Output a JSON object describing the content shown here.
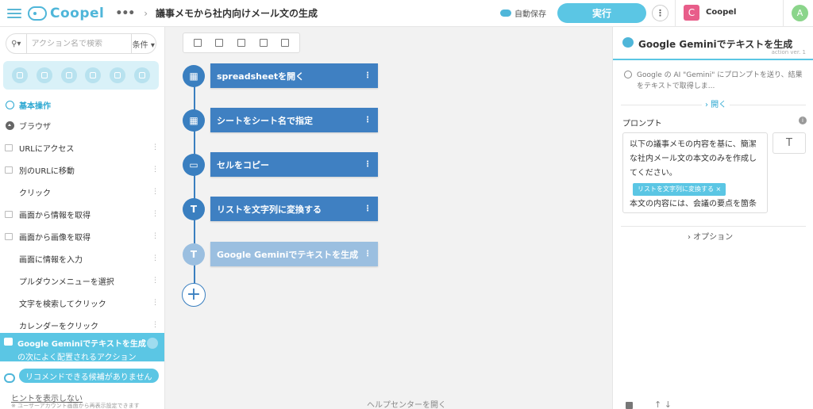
{
  "header": {
    "logo_text": "Coopel",
    "more_label": "•••",
    "breadcrumb_arrow": "›",
    "title": "議事メモから社内向けメール文の生成",
    "autosave": "自動保存",
    "run_button": "実行",
    "workspace_initial": "C",
    "workspace_name": "Coopel",
    "user_initial": "A"
  },
  "sidebar": {
    "search_placeholder": "アクション名で検索",
    "filter_label": "条件 ▾",
    "category_icons": [
      "globe-icon",
      "table-icon",
      "document-icon",
      "cloud-icon",
      "tools-icon",
      "sitemap-icon"
    ],
    "section_basic": "基本操作",
    "section_browser": "ブラウザ",
    "items": [
      {
        "label": "URLにアクセス",
        "icon": "window-icon"
      },
      {
        "label": "別のURLに移動",
        "icon": "window-icon"
      },
      {
        "label": "クリック",
        "icon": ""
      },
      {
        "label": "画面から情報を取得",
        "icon": "text-icon"
      },
      {
        "label": "画面から画像を取得",
        "icon": "image-icon"
      },
      {
        "label": "画面に情報を入力",
        "icon": ""
      },
      {
        "label": "プルダウンメニューを選択",
        "icon": ""
      },
      {
        "label": "文字を検索してクリック",
        "icon": ""
      },
      {
        "label": "カレンダーをクリック",
        "icon": ""
      }
    ],
    "recommend_title": "Google Geminiでテキストを生成",
    "recommend_sub": "の次によく配置されるアクション",
    "recommend_empty": "リコメンドできる候補がありません",
    "hint_link": "ヒントを表示しない",
    "hint_note": "※ ユーザーアカウント画面から再表示設定できます"
  },
  "canvas": {
    "toolbar": [
      "copy-icon",
      "hide-icon",
      "comment-icon",
      "split-icon",
      "layout-icon"
    ],
    "nodes": [
      {
        "label": "spreadsheetを開く",
        "icon_char": "▦",
        "icon_name": "spreadsheet-icon"
      },
      {
        "label": "シートをシート名で指定",
        "icon_char": "▦",
        "icon_name": "sheet-icon"
      },
      {
        "label": "セルをコピー",
        "icon_char": "▭",
        "icon_name": "cell-icon"
      },
      {
        "label": "リストを文字列に変換する",
        "icon_char": "T",
        "icon_name": "text-t-icon"
      },
      {
        "label": "Google Geminiでテキストを生成",
        "icon_char": "T",
        "icon_name": "text-t-icon"
      }
    ],
    "node_menu": "⋮",
    "add_symbol": "+",
    "help_link": "ヘルプセンターを開く"
  },
  "panel": {
    "title": "Google Geminiでテキストを生成",
    "version": "action ver. 1",
    "description": "Google の AI \"Gemini\" にプロンプトを送り、結果をテキストで取得しま...",
    "open_label": "›  開く",
    "prompt_label": "プロンプト",
    "info_char": "i",
    "prompt_text_1": "以下の議事メモの内容を基に、簡潔な社内メール文の本文のみを作成してください。",
    "prompt_tag": "リストを文字列に変換する",
    "prompt_tag_close": "×",
    "prompt_text_2": "本文の内容には、会議の要点を箇条",
    "t_button": "T",
    "option_label": "›  オプション",
    "arrows": "↑  ↓"
  },
  "colors": {
    "accent": "#5bc6e4",
    "node_blue": "#3f80c2",
    "node_faded": "#9bbfe0"
  }
}
